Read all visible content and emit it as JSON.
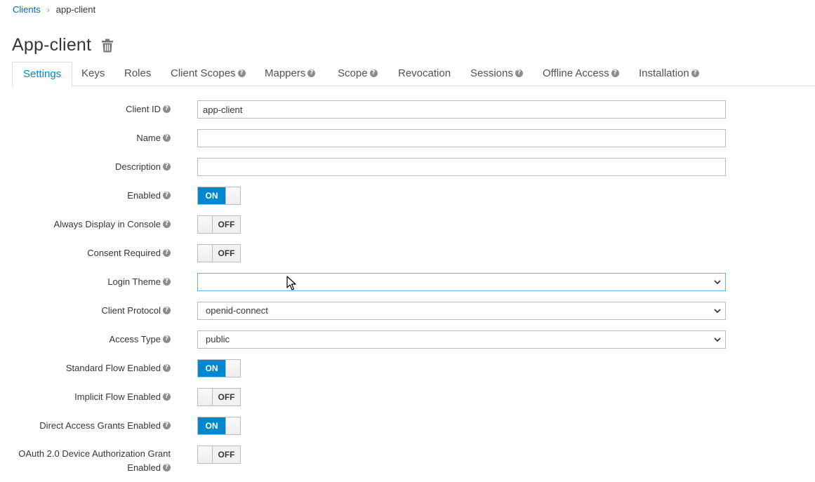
{
  "breadcrumb": {
    "parent": "Clients",
    "current": "app-client"
  },
  "page": {
    "title": "App-client"
  },
  "tabs": [
    {
      "label": "Settings",
      "help": false
    },
    {
      "label": "Keys",
      "help": false
    },
    {
      "label": "Roles",
      "help": false
    },
    {
      "label": "Client Scopes",
      "help": true
    },
    {
      "label": "Mappers",
      "help": true
    },
    {
      "label": "Scope",
      "help": true
    },
    {
      "label": "Revocation",
      "help": false
    },
    {
      "label": "Sessions",
      "help": true
    },
    {
      "label": "Offline Access",
      "help": true
    },
    {
      "label": "Installation",
      "help": true
    }
  ],
  "form": {
    "client_id": {
      "label": "Client ID",
      "value": "app-client"
    },
    "name": {
      "label": "Name",
      "value": ""
    },
    "description": {
      "label": "Description",
      "value": ""
    },
    "enabled": {
      "label": "Enabled",
      "state": "ON"
    },
    "always_display": {
      "label": "Always Display in Console",
      "state": "OFF"
    },
    "consent_required": {
      "label": "Consent Required",
      "state": "OFF"
    },
    "login_theme": {
      "label": "Login Theme",
      "value": ""
    },
    "client_protocol": {
      "label": "Client Protocol",
      "value": "openid-connect"
    },
    "access_type": {
      "label": "Access Type",
      "value": "public"
    },
    "standard_flow": {
      "label": "Standard Flow Enabled",
      "state": "ON"
    },
    "implicit_flow": {
      "label": "Implicit Flow Enabled",
      "state": "OFF"
    },
    "direct_access": {
      "label": "Direct Access Grants Enabled",
      "state": "ON"
    },
    "device_grant": {
      "label_line1": "OAuth 2.0 Device Authorization Grant",
      "label_line2": "Enabled",
      "state": "OFF"
    }
  },
  "colors": {
    "link": "#0066cc",
    "active_tab": "#0088ce",
    "toggle_on": "#0088ce",
    "border": "#bbbbbb"
  },
  "icons": {
    "delete": "trash-icon",
    "help": "help-icon",
    "dropdown": "chevron-down-icon"
  }
}
